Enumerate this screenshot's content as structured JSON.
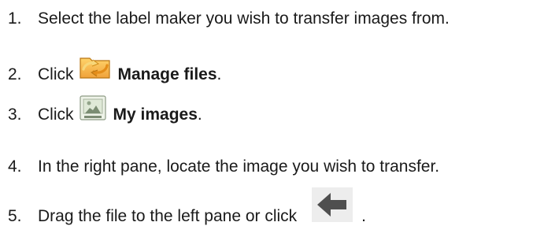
{
  "steps": [
    {
      "number": "1.",
      "text": "Select the label maker you wish to transfer images from."
    },
    {
      "number": "2.",
      "prefix": "Click",
      "bold": "Manage files",
      "suffix": ".",
      "icon": "folder-sync-icon"
    },
    {
      "number": "3.",
      "prefix": "Click",
      "bold": "My images",
      "suffix": ".",
      "icon": "image-icon"
    },
    {
      "number": "4.",
      "text": "In the right pane, locate the image you wish to transfer."
    },
    {
      "number": "5.",
      "prefix": "Drag the file to the left pane or click",
      "suffix": ".",
      "icon": "left-arrow-icon"
    }
  ],
  "colors": {
    "text": "#1a1a1a",
    "folder": "#f2a72b",
    "arrow": "#555555"
  }
}
